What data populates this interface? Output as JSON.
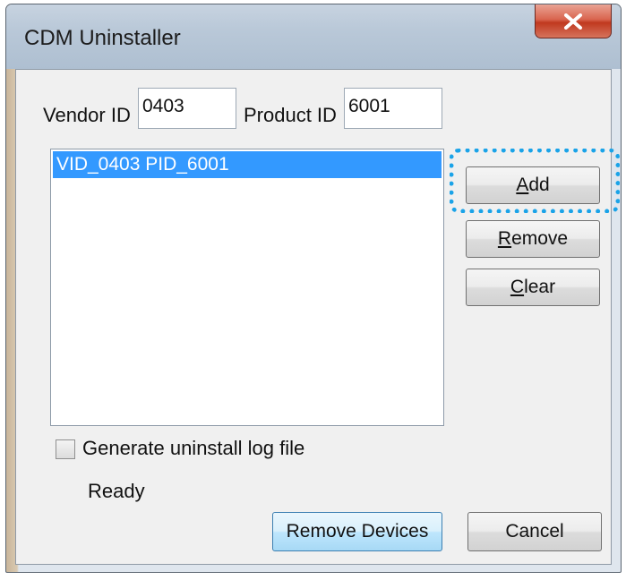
{
  "window": {
    "title": "CDM Uninstaller"
  },
  "vendor": {
    "label": "Vendor ID",
    "value": "0403"
  },
  "product": {
    "label": "Product ID",
    "value": "6001"
  },
  "list": {
    "items": [
      {
        "label": "VID_0403 PID_6001"
      }
    ]
  },
  "buttons": {
    "add": {
      "mnemonic": "A",
      "rest": "dd"
    },
    "remove": {
      "mnemonic": "R",
      "rest": "emove"
    },
    "clear": {
      "mnemonic": "C",
      "rest": "lear"
    },
    "remove_devices": "Remove Devices",
    "cancel": "Cancel"
  },
  "options": {
    "log_label": "Generate uninstall log file",
    "log_checked": false
  },
  "status": {
    "text": "Ready"
  },
  "icons": {
    "close": "close-icon"
  },
  "colors": {
    "selection": "#3399ff",
    "highlight_ring": "#1aa3e8",
    "close_button": "#c0391f"
  }
}
